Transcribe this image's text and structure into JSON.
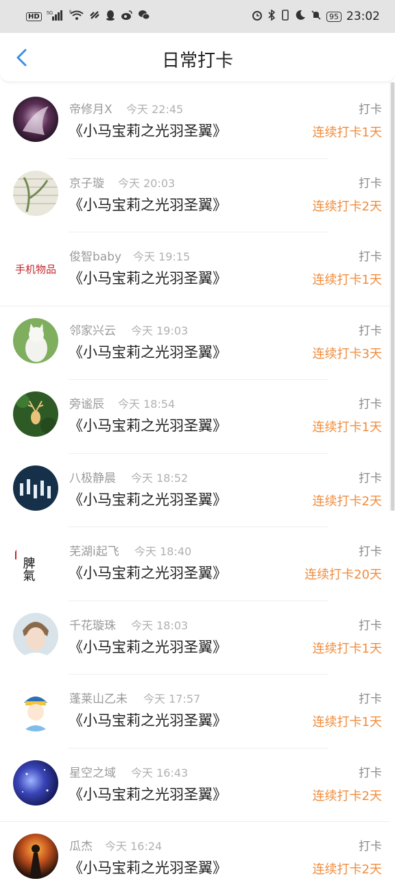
{
  "status_bar": {
    "left_icons": [
      "hd-badge",
      "signal-icon",
      "wifi-icon",
      "link-icon",
      "qq-icon",
      "weibo-icon",
      "wechat-icon"
    ],
    "hd_label": "HD",
    "net_5g": "5G",
    "net_6": "6",
    "right_icons": [
      "alarm-icon",
      "bluetooth-icon",
      "vibrate-icon",
      "moon-icon",
      "mute-icon",
      "battery-icon"
    ],
    "battery": "95",
    "time": "23:02"
  },
  "header": {
    "title": "日常打卡"
  },
  "records": [
    {
      "name": "帝修月X",
      "time": "今天 22:45",
      "book": "《小马宝莉之光羽圣翼》",
      "action": "打卡",
      "streak": "连续打卡1天"
    },
    {
      "name": "京子璇",
      "time": "今天 20:03",
      "book": "《小马宝莉之光羽圣翼》",
      "action": "打卡",
      "streak": "连续打卡2天"
    },
    {
      "name": "俊智baby",
      "time": "今天 19:15",
      "book": "《小马宝莉之光羽圣翼》",
      "action": "打卡",
      "streak": "连续打卡1天",
      "avatar_text": "手机物品"
    },
    {
      "name": "邻家兴云",
      "time": "今天 19:03",
      "book": "《小马宝莉之光羽圣翼》",
      "action": "打卡",
      "streak": "连续打卡3天"
    },
    {
      "name": "旁谧辰",
      "time": "今天 18:54",
      "book": "《小马宝莉之光羽圣翼》",
      "action": "打卡",
      "streak": "连续打卡1天"
    },
    {
      "name": "八极静晨",
      "time": "今天 18:52",
      "book": "《小马宝莉之光羽圣翼》",
      "action": "打卡",
      "streak": "连续打卡2天"
    },
    {
      "name": "芜湖i起飞",
      "time": "今天 18:40",
      "book": "《小马宝莉之光羽圣翼》",
      "action": "打卡",
      "streak": "连续打卡20天",
      "avatar_text": "脾氣"
    },
    {
      "name": "千花璇珠",
      "time": "今天 18:03",
      "book": "《小马宝莉之光羽圣翼》",
      "action": "打卡",
      "streak": "连续打卡1天"
    },
    {
      "name": "蓬莱山乙未",
      "time": "今天 17:57",
      "book": "《小马宝莉之光羽圣翼》",
      "action": "打卡",
      "streak": "连续打卡1天"
    },
    {
      "name": "星空之域",
      "time": "今天 16:43",
      "book": "《小马宝莉之光羽圣翼》",
      "action": "打卡",
      "streak": "连续打卡2天"
    },
    {
      "name": "瓜杰",
      "time": "今天 16:24",
      "book": "《小马宝莉之光羽圣翼》",
      "action": "打卡",
      "streak": "连续打卡2天"
    }
  ],
  "colors": {
    "accent": "#3a8ee6",
    "streak": "#f08c3c",
    "status_bar_bg": "#e4e4e4"
  }
}
